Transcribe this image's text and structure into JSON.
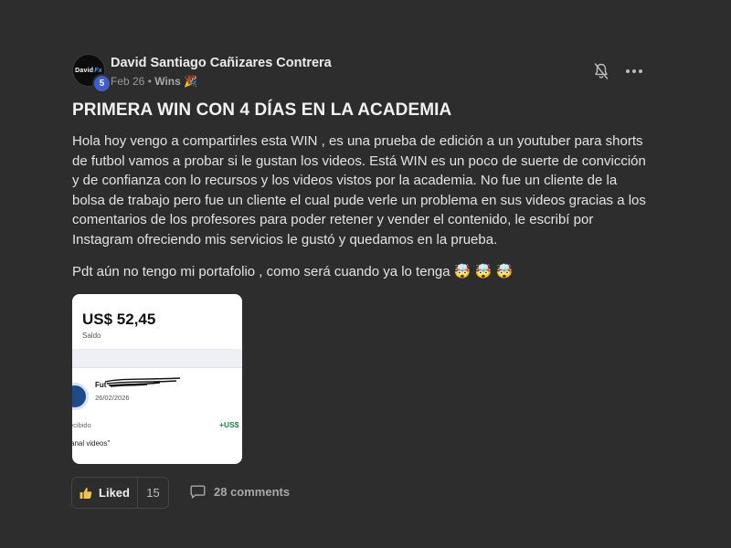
{
  "post": {
    "author": {
      "name": "David Santiago Cañizares Contrera",
      "avatar_text": "David",
      "avatar_accent": "Fx",
      "level": "5"
    },
    "date": "Feb 26",
    "separator": " • ",
    "category": "Wins",
    "category_emoji": "🎉",
    "title": "PRIMERA WIN CON 4 DÍAS EN LA ACADEMIA",
    "body": "Hola hoy vengo a compartirles esta WIN , es una prueba de edición a un youtuber para shorts de futbol vamos a probar si le gustan los videos. Está WIN es un poco de suerte de convicción y de confianza con lo recursos y los videos vistos por la academia. No fue un cliente de la bolsa de trabajo pero fue un cliente el cual pude verle un problema en sus videos gracias a los comentarios de los profesores para poder retener y vender el contenido, le escribí por Instagram ofreciendo mis servicios le gustó y quedamos en la prueba.",
    "pdt": "Pdt aún no tengo mi portafolio , como será cuando ya lo tenga 🤯 🤯 🤯",
    "icons": [
      "bell-off-icon",
      "more-icon",
      "thumbs-up-icon",
      "comment-icon"
    ],
    "attachment": {
      "amount": "US$ 52,45",
      "balance_label": "Saldo",
      "payer": "Fut",
      "date": "26/02/2026",
      "received_label": "ecibido",
      "amount_prefix": "+US$",
      "description": "anal videos\""
    },
    "footer": {
      "like_label": "Liked",
      "like_count": "15",
      "comments_label": "28 comments"
    }
  },
  "colors": {
    "background": "#2d2d2d",
    "level_badge": "#3f5ec9",
    "positive_amount": "#1a8a4a"
  }
}
